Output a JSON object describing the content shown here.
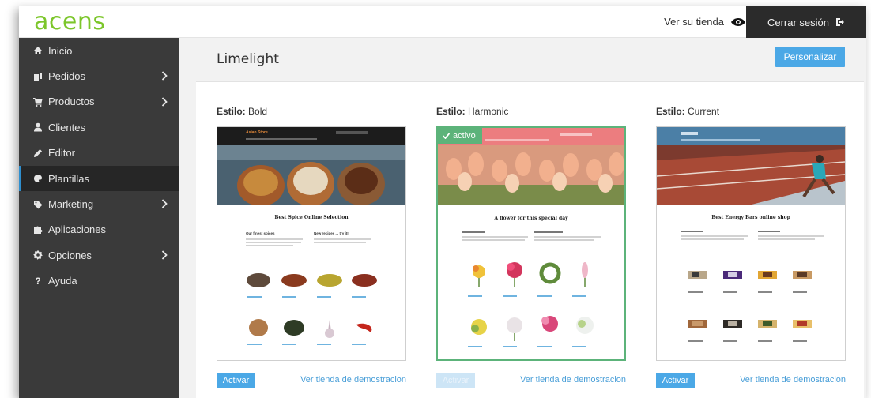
{
  "brand": {
    "logo": "acens",
    "color": "#7cc62b"
  },
  "topbar": {
    "view_store": "Ver su tienda",
    "logout": "Cerrar sesión"
  },
  "sidebar": {
    "items": [
      {
        "label": "Inicio",
        "icon": "home-icon",
        "chevron": false,
        "active": false
      },
      {
        "label": "Pedidos",
        "icon": "copy-icon",
        "chevron": true,
        "active": false
      },
      {
        "label": "Productos",
        "icon": "cart-icon",
        "chevron": true,
        "active": false
      },
      {
        "label": "Clientes",
        "icon": "user-icon",
        "chevron": false,
        "active": false
      },
      {
        "label": "Editor",
        "icon": "pencil-icon",
        "chevron": false,
        "active": false
      },
      {
        "label": "Plantillas",
        "icon": "palette-icon",
        "chevron": false,
        "active": true
      },
      {
        "label": "Marketing",
        "icon": "tag-icon",
        "chevron": true,
        "active": false
      },
      {
        "label": "Aplicaciones",
        "icon": "puzzle-icon",
        "chevron": false,
        "active": false
      },
      {
        "label": "Opciones",
        "icon": "gear-icon",
        "chevron": true,
        "active": false
      },
      {
        "label": "Ayuda",
        "icon": "question-icon",
        "chevron": false,
        "active": false
      }
    ]
  },
  "main": {
    "title": "Limelight",
    "customize": "Personalizar",
    "style_prefix": "Estilo:",
    "themes": [
      {
        "name": "Bold",
        "activate": "Activar",
        "demo": "Ver tienda de demostracion",
        "is_active": false,
        "preview": {
          "brand": "Asian Store",
          "heading": "Best Spice Online Selection",
          "col1": "Our finest spices",
          "col2": "New recipes ... try it!"
        }
      },
      {
        "name": "Harmonic",
        "activate": "Activar",
        "demo": "Ver tienda de demostracion",
        "is_active": true,
        "badge": "activo",
        "preview": {
          "heading": "A flower for this special day"
        }
      },
      {
        "name": "Current",
        "activate": "Activar",
        "demo": "Ver tienda de demostracion",
        "is_active": false,
        "preview": {
          "heading": "Best Energy Bars online shop"
        }
      }
    ]
  },
  "colors": {
    "accent": "#4ba8e6",
    "active_green": "#5cb37a",
    "sidebar": "#3a3a3a",
    "topbar_dark": "#2b2b2b"
  }
}
